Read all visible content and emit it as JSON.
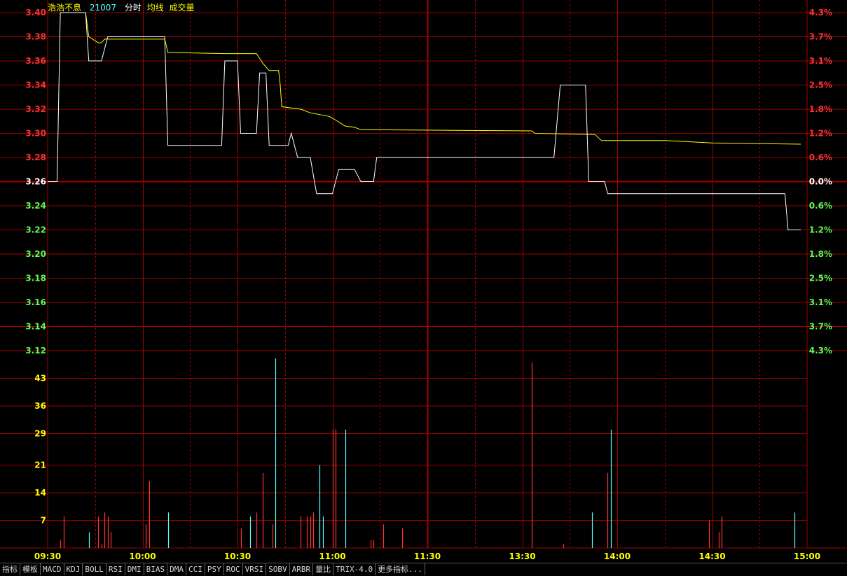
{
  "header": {
    "stock_name": "浩浩不息",
    "stock_code": "21007",
    "legend": [
      "分时",
      "均线",
      "成交量"
    ]
  },
  "colors": {
    "up": "#ff3232",
    "down": "#54ff54",
    "neutral": "#ffffff",
    "price_line": "#ffffff",
    "avg_line": "#ffff00",
    "grid": "#a00000",
    "volume_up": "#ff3232",
    "volume_down": "#54ffff",
    "volume_axis": "#ffff00"
  },
  "tabs": [
    "指标",
    "模板",
    "MACD",
    "KDJ",
    "BOLL",
    "RSI",
    "DMI",
    "BIAS",
    "DMA",
    "CCI",
    "PSY",
    "ROC",
    "VRSI",
    "SOBV",
    "ARBR",
    "量比",
    "TRIX-4.0",
    "更多指标..."
  ],
  "chart_data": {
    "type": "line",
    "base_price": 3.26,
    "price_axis": {
      "ticks": [
        "3.40",
        "3.38",
        "3.36",
        "3.34",
        "3.32",
        "3.30",
        "3.28",
        "3.26",
        "3.24",
        "3.22",
        "3.20",
        "3.18",
        "3.16",
        "3.14",
        "3.12"
      ],
      "ylim": [
        3.12,
        3.4
      ]
    },
    "percent_axis": {
      "ticks": [
        "4.3%",
        "3.7%",
        "3.1%",
        "2.5%",
        "1.8%",
        "1.2%",
        "0.6%",
        "0.0%",
        "0.6%",
        "1.2%",
        "1.8%",
        "2.5%",
        "3.1%",
        "3.7%",
        "4.3%"
      ]
    },
    "volume_axis": {
      "ticks": [
        "43",
        "36",
        "29",
        "21",
        "14",
        "7"
      ],
      "ylim": [
        0,
        50
      ]
    },
    "time_labels": [
      "09:30",
      "10:00",
      "10:30",
      "11:00",
      "11:30",
      "13:30",
      "14:00",
      "14:30",
      "15:00"
    ],
    "xlim": [
      0,
      240
    ],
    "price_series": [
      [
        0,
        3.26
      ],
      [
        3,
        3.26
      ],
      [
        4,
        3.4
      ],
      [
        12,
        3.4
      ],
      [
        13,
        3.36
      ],
      [
        17,
        3.36
      ],
      [
        18,
        3.37
      ],
      [
        19,
        3.38
      ],
      [
        37,
        3.38
      ],
      [
        38,
        3.29
      ],
      [
        55,
        3.29
      ],
      [
        56,
        3.36
      ],
      [
        60,
        3.36
      ],
      [
        61,
        3.3
      ],
      [
        66,
        3.3
      ],
      [
        67,
        3.35
      ],
      [
        69,
        3.35
      ],
      [
        70,
        3.29
      ],
      [
        76,
        3.29
      ],
      [
        77,
        3.3
      ],
      [
        79,
        3.28
      ],
      [
        83,
        3.28
      ],
      [
        85,
        3.25
      ],
      [
        90,
        3.25
      ],
      [
        92,
        3.27
      ],
      [
        97,
        3.27
      ],
      [
        99,
        3.26
      ],
      [
        103,
        3.26
      ],
      [
        104,
        3.28
      ],
      [
        160,
        3.28
      ],
      [
        162,
        3.34
      ],
      [
        170,
        3.34
      ],
      [
        171,
        3.26
      ],
      [
        176,
        3.26
      ],
      [
        177,
        3.25
      ],
      [
        233,
        3.25
      ],
      [
        234,
        3.22
      ],
      [
        238,
        3.22
      ]
    ],
    "avg_series": [
      [
        4,
        3.4
      ],
      [
        12,
        3.4
      ],
      [
        13,
        3.38
      ],
      [
        16,
        3.375
      ],
      [
        17,
        3.375
      ],
      [
        18,
        3.378
      ],
      [
        37,
        3.378
      ],
      [
        38,
        3.367
      ],
      [
        56,
        3.366
      ],
      [
        66,
        3.366
      ],
      [
        67,
        3.362
      ],
      [
        68,
        3.358
      ],
      [
        70,
        3.352
      ],
      [
        73,
        3.352
      ],
      [
        73.5,
        3.34
      ],
      [
        74,
        3.322
      ],
      [
        80,
        3.32
      ],
      [
        83,
        3.317
      ],
      [
        89,
        3.314
      ],
      [
        91,
        3.311
      ],
      [
        94,
        3.306
      ],
      [
        97,
        3.305
      ],
      [
        99,
        3.303
      ],
      [
        153,
        3.302
      ],
      [
        154,
        3.3
      ],
      [
        173,
        3.299
      ],
      [
        175,
        3.294
      ],
      [
        195,
        3.294
      ],
      [
        210,
        3.292
      ],
      [
        238,
        3.291
      ]
    ],
    "volume_series": [
      [
        4,
        2,
        "up"
      ],
      [
        5,
        8,
        "up"
      ],
      [
        13,
        4,
        "down"
      ],
      [
        16,
        8,
        "up"
      ],
      [
        17,
        1,
        "up"
      ],
      [
        18,
        9,
        "up"
      ],
      [
        19,
        8,
        "up"
      ],
      [
        20,
        4,
        "up"
      ],
      [
        31,
        6,
        "up"
      ],
      [
        32,
        17,
        "up"
      ],
      [
        38,
        9,
        "down"
      ],
      [
        61,
        5,
        "up"
      ],
      [
        64,
        8,
        "down"
      ],
      [
        66,
        9,
        "up"
      ],
      [
        68,
        19,
        "up"
      ],
      [
        71,
        6,
        "up"
      ],
      [
        72,
        48,
        "down"
      ],
      [
        80,
        8,
        "up"
      ],
      [
        82,
        8,
        "up"
      ],
      [
        83,
        8,
        "up"
      ],
      [
        84,
        9,
        "up"
      ],
      [
        86,
        21,
        "down"
      ],
      [
        87,
        8,
        "down"
      ],
      [
        90,
        30,
        "up"
      ],
      [
        91,
        30,
        "up"
      ],
      [
        94,
        30,
        "down"
      ],
      [
        102,
        2,
        "up"
      ],
      [
        103,
        2,
        "up"
      ],
      [
        106,
        6,
        "up"
      ],
      [
        112,
        5,
        "up"
      ],
      [
        153,
        47,
        "up"
      ],
      [
        163,
        1,
        "up"
      ],
      [
        172,
        9,
        "down"
      ],
      [
        177,
        19,
        "up"
      ],
      [
        178,
        30,
        "down"
      ],
      [
        209,
        7,
        "up"
      ],
      [
        212,
        4,
        "up"
      ],
      [
        213,
        8,
        "up"
      ],
      [
        236,
        9,
        "down"
      ]
    ]
  }
}
